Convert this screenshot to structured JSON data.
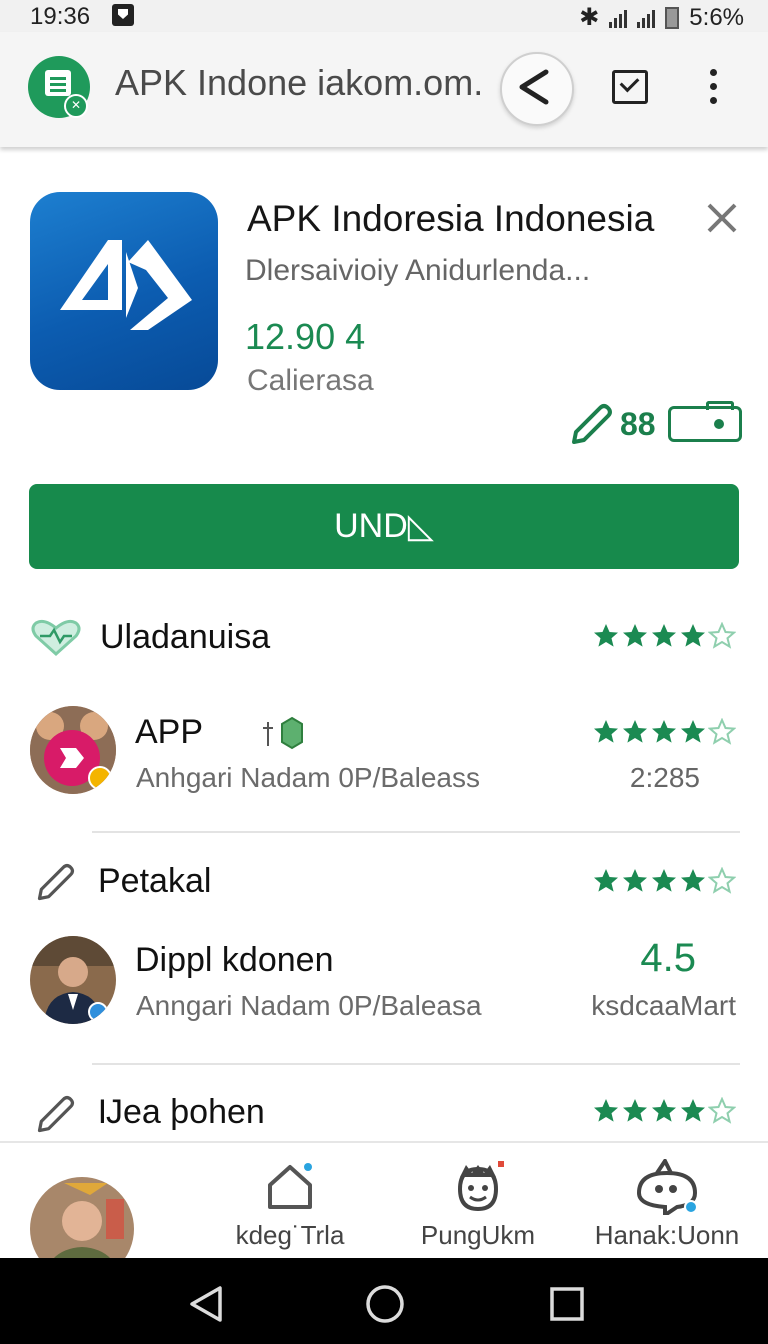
{
  "status": {
    "time": "19:36",
    "battery": "5:6%"
  },
  "browser": {
    "url": "APK Indone iakom.om."
  },
  "app": {
    "name": "APK Indoresia Indonesia",
    "developer": "Dlersaivioiy Anidurlenda...",
    "rating": "12.90 4",
    "category": "Calierasa",
    "mini_count": "88",
    "install_label": "UND◺"
  },
  "sections": [
    {
      "title": "Uladanuisa",
      "stars": 4
    },
    {
      "title": "APP",
      "subtitle": "Anhgari Nadam 0P/Baleass",
      "stars": 4,
      "right": "2:285"
    },
    {
      "title": "Petakal",
      "stars": 4
    },
    {
      "title": "Dippl kdonen",
      "subtitle": "Anngari Nadam 0P/Baleasa",
      "value": "4.5",
      "right": "ksdcaaMart"
    },
    {
      "title": "Ĳea þohen",
      "stars": 4
    }
  ],
  "bottom_nav": [
    {
      "label": "kdeg˙Trla",
      "icon": "home-icon"
    },
    {
      "label": "PungUkm",
      "icon": "face-icon"
    },
    {
      "label": "Hanak:Uonn",
      "icon": "chat-icon"
    }
  ],
  "colors": {
    "accent": "#178a4c",
    "star": "#1b8a52",
    "app_icon": "#0c5cb0"
  }
}
